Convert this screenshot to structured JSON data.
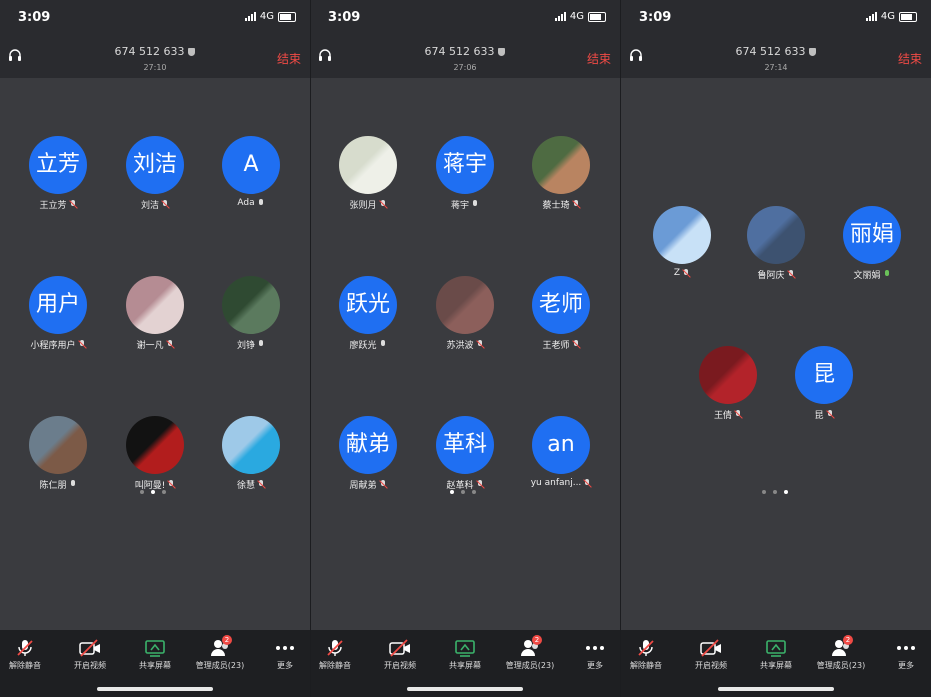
{
  "screens": [
    {
      "status": {
        "time": "3:09",
        "network": "4G"
      },
      "header": {
        "meeting_id": "674 512 633",
        "duration": "27:10",
        "end_label": "结束"
      },
      "participants": [
        {
          "initials": "立芳",
          "name": "王立芳",
          "mic": "muted"
        },
        {
          "initials": "刘洁",
          "name": "刘洁",
          "mic": "muted"
        },
        {
          "initials": "A",
          "name": "Ada",
          "mic": "on"
        },
        {
          "initials": "用户",
          "name": "小程序用户",
          "mic": "muted"
        },
        {
          "initials": "",
          "name": "谢一凡",
          "mic": "muted",
          "photo": [
            "#b58c93",
            "#e3d2d2"
          ]
        },
        {
          "initials": "",
          "name": "刘铮",
          "mic": "on",
          "photo": [
            "#2f4a32",
            "#5b7a5e"
          ]
        },
        {
          "initials": "",
          "name": "陈仁朋",
          "mic": "on",
          "photo": [
            "#6b7d8c",
            "#7c5a47"
          ]
        },
        {
          "initials": "",
          "name": "叫阿曼!",
          "mic": "muted",
          "photo": [
            "#121212",
            "#b21d1d"
          ]
        },
        {
          "initials": "",
          "name": "徐慧",
          "mic": "muted",
          "photo": [
            "#9ec9e8",
            "#2aa9e0"
          ]
        }
      ],
      "page_dots": {
        "count": 3,
        "active": 1
      }
    },
    {
      "status": {
        "time": "3:09",
        "network": "4G"
      },
      "header": {
        "meeting_id": "674 512 633",
        "duration": "27:06",
        "end_label": "结束"
      },
      "participants": [
        {
          "initials": "",
          "name": "张则月",
          "mic": "muted",
          "photo": [
            "#d7dccd",
            "#eef0e8"
          ]
        },
        {
          "initials": "蒋宇",
          "name": "蒋宇",
          "mic": "on"
        },
        {
          "initials": "",
          "name": "蔡士琦",
          "mic": "muted",
          "photo": [
            "#4e6b42",
            "#b98461"
          ]
        },
        {
          "initials": "跃光",
          "name": "廖跃光",
          "mic": "on"
        },
        {
          "initials": "",
          "name": "苏洪波",
          "mic": "muted",
          "photo": [
            "#6a4b49",
            "#8c5f5b"
          ]
        },
        {
          "initials": "老师",
          "name": "王老师",
          "mic": "muted"
        },
        {
          "initials": "献弟",
          "name": "周献弟",
          "mic": "muted"
        },
        {
          "initials": "革科",
          "name": "赵革科",
          "mic": "muted"
        },
        {
          "initials": "an",
          "name": "yu anfanj...",
          "mic": "muted"
        }
      ],
      "page_dots": {
        "count": 3,
        "active": 0
      }
    },
    {
      "status": {
        "time": "3:09",
        "network": "4G"
      },
      "header": {
        "meeting_id": "674 512 633",
        "duration": "27:14",
        "end_label": "结束"
      },
      "participants": [
        {
          "initials": "",
          "name": "Z",
          "mic": "muted",
          "photo": [
            "#6b9bd6",
            "#c8e1f7"
          ]
        },
        {
          "initials": "",
          "name": "鲁阿庆",
          "mic": "muted",
          "photo": [
            "#4f6fa0",
            "#3d5270"
          ]
        },
        {
          "initials": "丽娟",
          "name": "文丽娟",
          "mic": "green"
        },
        {
          "initials": "",
          "name": "王倩",
          "mic": "muted",
          "photo": [
            "#7a1a1f",
            "#b3232a"
          ]
        },
        {
          "initials": "昆",
          "name": "昆",
          "mic": "muted"
        }
      ],
      "page_dots": {
        "count": 3,
        "active": 2
      }
    }
  ],
  "toolbar": [
    {
      "id": "unmute",
      "label": "解除静音",
      "icon": "mic-muted-icon"
    },
    {
      "id": "video",
      "label": "开启视频",
      "icon": "camera-off-icon"
    },
    {
      "id": "share",
      "label": "共享屏幕",
      "icon": "screen-share-icon"
    },
    {
      "id": "members",
      "label": "管理成员(23)",
      "icon": "members-icon",
      "badge": "2"
    },
    {
      "id": "more",
      "label": "更多",
      "icon": "more-icon"
    }
  ],
  "colors": {
    "accent": "#1f6ff2",
    "end": "#f04a45",
    "share": "#3bb36b"
  }
}
